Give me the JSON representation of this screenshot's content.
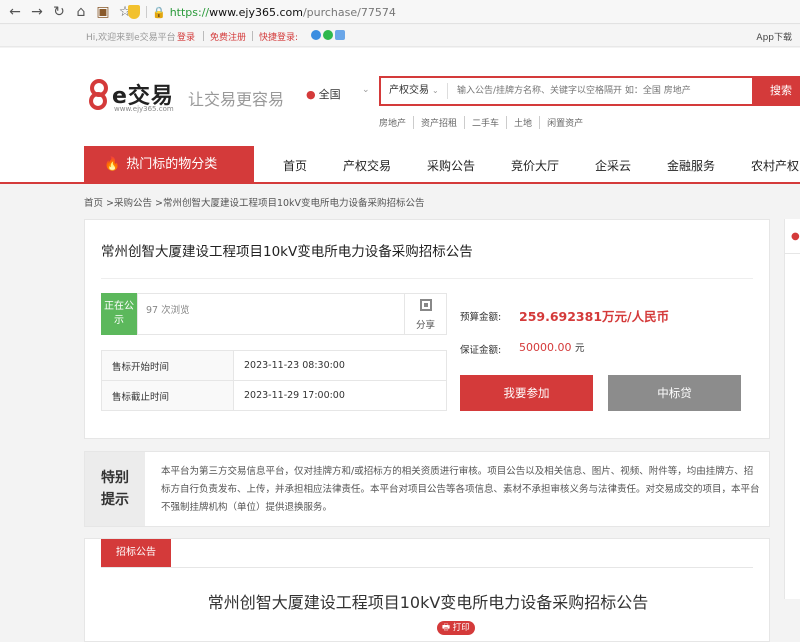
{
  "browser": {
    "url_proto": "https://",
    "url_host": "www.ejy365.com",
    "url_path": "/purchase/77574",
    "nav_icons": [
      "back-arrow-icon",
      "forward-arrow-icon",
      "reload-icon",
      "home-icon",
      "extension-icon",
      "star-icon"
    ]
  },
  "topbar": {
    "welcome": "Hi,欢迎来到e交易平台",
    "login": "登录",
    "register": "免费注册",
    "quick_login": "快捷登录:",
    "app_download": "App下载",
    "social_colors": [
      "#3a8de0",
      "#2db84d",
      "#6aa6e8"
    ]
  },
  "header": {
    "logo_text": "e交易",
    "logo_url": "www.ejy365.com",
    "slogan": "让交易更容易",
    "region": "全国",
    "search_category": "产权交易",
    "search_placeholder": "输入公告/挂牌方名称、关键字以空格隔开 如：全国 房地产",
    "search_button": "搜索",
    "hot_links": [
      "房地产",
      "资产招租",
      "二手车",
      "土地",
      "闲置资产"
    ],
    "accent": "#d43a3a"
  },
  "mainnav": {
    "category_button": "热门标的物分类",
    "items": [
      "首页",
      "产权交易",
      "采购公告",
      "竞价大厅",
      "企采云",
      "金融服务",
      "农村产权"
    ]
  },
  "breadcrumb": "首页 >采购公告 >常州创智大厦建设工程项目10kV变电所电力设备采购招标公告",
  "detail": {
    "title": "常州创智大厦建设工程项目10kV变电所电力设备采购招标公告",
    "status": "正在公示",
    "views": "97 次浏览",
    "share": "分享",
    "rows": [
      {
        "k": "售标开始时间",
        "v": "2023-11-23 08:30:00"
      },
      {
        "k": "售标截止时间",
        "v": "2023-11-29 17:00:00"
      }
    ],
    "budget_label": "预算金额:",
    "budget_value": "259.692381万元/人民币",
    "deposit_label": "保证金额:",
    "deposit_value": "50000.00",
    "deposit_unit": "元",
    "join_button": "我要参加",
    "loan_button": "中标贷"
  },
  "notice": {
    "title_line1": "特别",
    "title_line2": "提示",
    "body": "本平台为第三方交易信息平台，仅对挂牌方和/或招标方的相关资质进行审核。项目公告以及相关信息、图片、视频、附件等，均由挂牌方、招标方自行负责发布、上传，并承担相应法律责任。本平台对项目公告等各项信息、素材不承担审核义务与法律责任。对交易成交的项目，本平台不强制挂牌机构（单位）提供退换服务。"
  },
  "announcement": {
    "tab": "招标公告",
    "title": "常州创智大厦建设工程项目10kV变电所电力设备采购招标公告",
    "print": "打印"
  }
}
